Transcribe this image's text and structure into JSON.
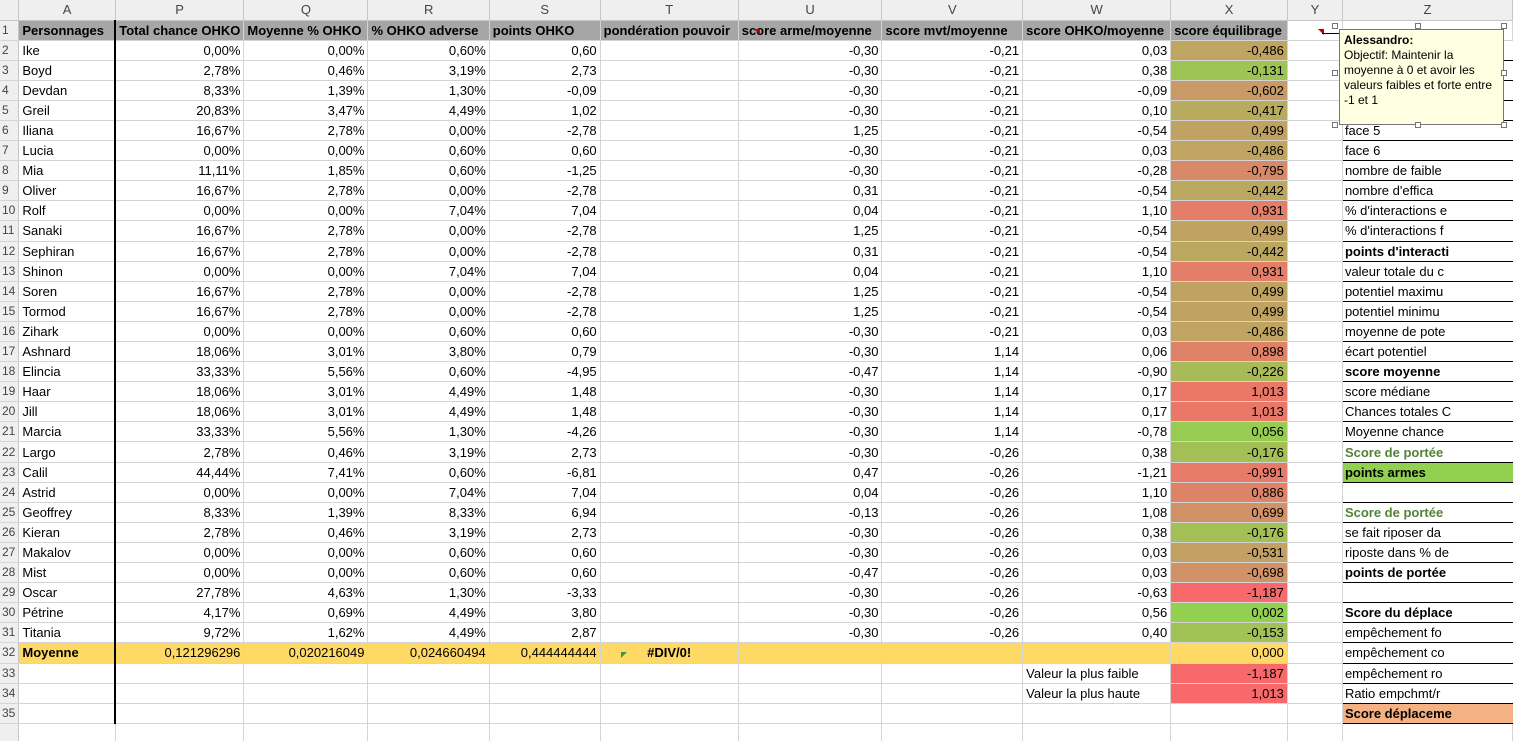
{
  "columns": [
    "A",
    "P",
    "Q",
    "R",
    "S",
    "T",
    "U",
    "V",
    "W",
    "X",
    "Y",
    "Z"
  ],
  "headers": [
    "Personnages",
    "Total chance OHKO",
    "Moyenne % OHKO",
    "% OHKO adverse",
    "points OHKO",
    "pondération pouvoir",
    "score arme/moyenne",
    "score mvt/moyenne",
    "score OHKO/moyenne",
    "score équilibrage",
    "",
    ""
  ],
  "rows": [
    {
      "n": "2",
      "a": "Ike",
      "p": "0,00%",
      "q": "0,00%",
      "r": "0,60%",
      "s": "0,60",
      "t": "",
      "u": "-0,30",
      "v": "-0,21",
      "w": "0,03",
      "x": "-0,486",
      "z": ""
    },
    {
      "n": "3",
      "a": "Boyd",
      "p": "2,78%",
      "q": "0,46%",
      "r": "3,19%",
      "s": "2,73",
      "t": "",
      "u": "-0,30",
      "v": "-0,21",
      "w": "0,38",
      "x": "-0,131",
      "z": ""
    },
    {
      "n": "4",
      "a": "Devdan",
      "p": "8,33%",
      "q": "1,39%",
      "r": "1,30%",
      "s": "-0,09",
      "t": "",
      "u": "-0,30",
      "v": "-0,21",
      "w": "-0,09",
      "x": "-0,602",
      "z": ""
    },
    {
      "n": "5",
      "a": "Greil",
      "p": "20,83%",
      "q": "3,47%",
      "r": "4,49%",
      "s": "1,02",
      "t": "",
      "u": "-0,30",
      "v": "-0,21",
      "w": "0,10",
      "x": "-0,417",
      "z": ""
    },
    {
      "n": "6",
      "a": "Iliana",
      "p": "16,67%",
      "q": "2,78%",
      "r": "0,00%",
      "s": "-2,78",
      "t": "",
      "u": "1,25",
      "v": "-0,21",
      "w": "-0,54",
      "x": "0,499",
      "z": "face 5"
    },
    {
      "n": "7",
      "a": "Lucia",
      "p": "0,00%",
      "q": "0,00%",
      "r": "0,60%",
      "s": "0,60",
      "t": "",
      "u": "-0,30",
      "v": "-0,21",
      "w": "0,03",
      "x": "-0,486",
      "z": "face 6"
    },
    {
      "n": "8",
      "a": "Mia",
      "p": "11,11%",
      "q": "1,85%",
      "r": "0,60%",
      "s": "-1,25",
      "t": "",
      "u": "-0,30",
      "v": "-0,21",
      "w": "-0,28",
      "x": "-0,795",
      "z": "nombre de faible"
    },
    {
      "n": "9",
      "a": "Oliver",
      "p": "16,67%",
      "q": "2,78%",
      "r": "0,00%",
      "s": "-2,78",
      "t": "",
      "u": "0,31",
      "v": "-0,21",
      "w": "-0,54",
      "x": "-0,442",
      "z": "nombre d'effica"
    },
    {
      "n": "10",
      "a": "Rolf",
      "p": "0,00%",
      "q": "0,00%",
      "r": "7,04%",
      "s": "7,04",
      "t": "",
      "u": "0,04",
      "v": "-0,21",
      "w": "1,10",
      "x": "0,931",
      "z": "% d'interactions e"
    },
    {
      "n": "11",
      "a": "Sanaki",
      "p": "16,67%",
      "q": "2,78%",
      "r": "0,00%",
      "s": "-2,78",
      "t": "",
      "u": "1,25",
      "v": "-0,21",
      "w": "-0,54",
      "x": "0,499",
      "z": "% d'interactions f"
    },
    {
      "n": "12",
      "a": "Sephiran",
      "p": "16,67%",
      "q": "2,78%",
      "r": "0,00%",
      "s": "-2,78",
      "t": "",
      "u": "0,31",
      "v": "-0,21",
      "w": "-0,54",
      "x": "-0,442",
      "z": "points d'interacti"
    },
    {
      "n": "13",
      "a": "Shinon",
      "p": "0,00%",
      "q": "0,00%",
      "r": "7,04%",
      "s": "7,04",
      "t": "",
      "u": "0,04",
      "v": "-0,21",
      "w": "1,10",
      "x": "0,931",
      "z": "valeur totale du c"
    },
    {
      "n": "14",
      "a": "Soren",
      "p": "16,67%",
      "q": "2,78%",
      "r": "0,00%",
      "s": "-2,78",
      "t": "",
      "u": "1,25",
      "v": "-0,21",
      "w": "-0,54",
      "x": "0,499",
      "z": "potentiel maximu"
    },
    {
      "n": "15",
      "a": "Tormod",
      "p": "16,67%",
      "q": "2,78%",
      "r": "0,00%",
      "s": "-2,78",
      "t": "",
      "u": "1,25",
      "v": "-0,21",
      "w": "-0,54",
      "x": "0,499",
      "z": "potentiel minimu"
    },
    {
      "n": "16",
      "a": "Zihark",
      "p": "0,00%",
      "q": "0,00%",
      "r": "0,60%",
      "s": "0,60",
      "t": "",
      "u": "-0,30",
      "v": "-0,21",
      "w": "0,03",
      "x": "-0,486",
      "z": "moyenne de pote"
    },
    {
      "n": "17",
      "a": "Ashnard",
      "p": "18,06%",
      "q": "3,01%",
      "r": "3,80%",
      "s": "0,79",
      "t": "",
      "u": "-0,30",
      "v": "1,14",
      "w": "0,06",
      "x": "0,898",
      "z": "écart potentiel"
    },
    {
      "n": "18",
      "a": "Elincia",
      "p": "33,33%",
      "q": "5,56%",
      "r": "0,60%",
      "s": "-4,95",
      "t": "",
      "u": "-0,47",
      "v": "1,14",
      "w": "-0,90",
      "x": "-0,226",
      "z": "score moyenne"
    },
    {
      "n": "19",
      "a": "Haar",
      "p": "18,06%",
      "q": "3,01%",
      "r": "4,49%",
      "s": "1,48",
      "t": "",
      "u": "-0,30",
      "v": "1,14",
      "w": "0,17",
      "x": "1,013",
      "z": "score médiane"
    },
    {
      "n": "20",
      "a": "Jill",
      "p": "18,06%",
      "q": "3,01%",
      "r": "4,49%",
      "s": "1,48",
      "t": "",
      "u": "-0,30",
      "v": "1,14",
      "w": "0,17",
      "x": "1,013",
      "z": "Chances totales C"
    },
    {
      "n": "21",
      "a": "Marcia",
      "p": "33,33%",
      "q": "5,56%",
      "r": "1,30%",
      "s": "-4,26",
      "t": "",
      "u": "-0,30",
      "v": "1,14",
      "w": "-0,78",
      "x": "0,056",
      "z": "Moyenne chance"
    },
    {
      "n": "22",
      "a": "Largo",
      "p": "2,78%",
      "q": "0,46%",
      "r": "3,19%",
      "s": "2,73",
      "t": "",
      "u": "-0,30",
      "v": "-0,26",
      "w": "0,38",
      "x": "-0,176",
      "z": "Score de portée"
    },
    {
      "n": "23",
      "a": "Calil",
      "p": "44,44%",
      "q": "7,41%",
      "r": "0,60%",
      "s": "-6,81",
      "t": "",
      "u": "0,47",
      "v": "-0,26",
      "w": "-1,21",
      "x": "-0,991",
      "z": "points armes"
    },
    {
      "n": "24",
      "a": "Astrid",
      "p": "0,00%",
      "q": "0,00%",
      "r": "7,04%",
      "s": "7,04",
      "t": "",
      "u": "0,04",
      "v": "-0,26",
      "w": "1,10",
      "x": "0,886",
      "z": ""
    },
    {
      "n": "25",
      "a": "Geoffrey",
      "p": "8,33%",
      "q": "1,39%",
      "r": "8,33%",
      "s": "6,94",
      "t": "",
      "u": "-0,13",
      "v": "-0,26",
      "w": "1,08",
      "x": "0,699",
      "z": "Score de portée"
    },
    {
      "n": "26",
      "a": "Kieran",
      "p": "2,78%",
      "q": "0,46%",
      "r": "3,19%",
      "s": "2,73",
      "t": "",
      "u": "-0,30",
      "v": "-0,26",
      "w": "0,38",
      "x": "-0,176",
      "z": "se fait riposer da"
    },
    {
      "n": "27",
      "a": "Makalov",
      "p": "0,00%",
      "q": "0,00%",
      "r": "0,60%",
      "s": "0,60",
      "t": "",
      "u": "-0,30",
      "v": "-0,26",
      "w": "0,03",
      "x": "-0,531",
      "z": "riposte dans % de"
    },
    {
      "n": "28",
      "a": "Mist",
      "p": "0,00%",
      "q": "0,00%",
      "r": "0,60%",
      "s": "0,60",
      "t": "",
      "u": "-0,47",
      "v": "-0,26",
      "w": "0,03",
      "x": "-0,698",
      "z": "points de portée"
    },
    {
      "n": "29",
      "a": "Oscar",
      "p": "27,78%",
      "q": "4,63%",
      "r": "1,30%",
      "s": "-3,33",
      "t": "",
      "u": "-0,30",
      "v": "-0,26",
      "w": "-0,63",
      "x": "-1,187",
      "z": ""
    },
    {
      "n": "30",
      "a": "Pétrine",
      "p": "4,17%",
      "q": "0,69%",
      "r": "4,49%",
      "s": "3,80",
      "t": "",
      "u": "-0,30",
      "v": "-0,26",
      "w": "0,56",
      "x": "0,002",
      "z": "Score du déplace"
    },
    {
      "n": "31",
      "a": "Titania",
      "p": "9,72%",
      "q": "1,62%",
      "r": "4,49%",
      "s": "2,87",
      "t": "",
      "u": "-0,30",
      "v": "-0,26",
      "w": "0,40",
      "x": "-0,153",
      "z": "empêchement fo"
    }
  ],
  "average_row": {
    "n": "32",
    "label": "Moyenne",
    "p": "0,121296296",
    "q": "0,020216049",
    "r": "0,024660494",
    "s": "0,444444444",
    "t": "#DIV/0!",
    "x": "0,000",
    "z": "empêchement co"
  },
  "row33": {
    "n": "33",
    "w": "Valeur la plus faible",
    "x": "-1,187",
    "z": "empêchement ro"
  },
  "row34": {
    "n": "34",
    "w": "Valeur la plus haute",
    "x": "1,013",
    "z": "Ratio empchmt/r"
  },
  "row35": {
    "n": "35",
    "z": "Score déplaceme"
  },
  "comment": {
    "author": "Alessandro:",
    "text": "Objectif: Maintenir la moyenne à 0 et avoir les valeurs faibles et forte entre -1 et 1"
  },
  "colors": {
    "header_bg": "#a6a6a6",
    "average_bg": "#ffd966",
    "scale_green": "#92d050",
    "scale_red": "#f8696b",
    "comment_bg": "#ffffe1",
    "z_green_text": "#548235",
    "z_orange_bg": "#f4b183"
  }
}
